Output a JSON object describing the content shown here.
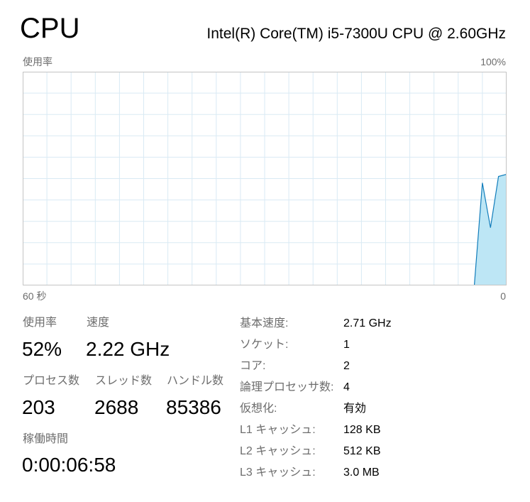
{
  "header": {
    "title": "CPU",
    "model": "Intel(R) Core(TM) i5-7300U CPU @ 2.60GHz"
  },
  "graph": {
    "label_top_left": "使用率",
    "label_top_right": "100%",
    "label_bottom_left": "60 秒",
    "label_bottom_right": "0",
    "line_color": "#117dbb",
    "fill_color": "#bde6f5",
    "grid_color": "#d9eaf4",
    "chart_data": {
      "type": "area",
      "x": [
        60,
        4,
        3,
        2,
        1,
        0
      ],
      "values": [
        0,
        0,
        48,
        27,
        51,
        52
      ],
      "ylim": [
        0,
        100
      ],
      "grid": true
    }
  },
  "stats": {
    "usage": {
      "label": "使用率",
      "value": "52%"
    },
    "speed": {
      "label": "速度",
      "value": "2.22 GHz"
    },
    "processes": {
      "label": "プロセス数",
      "value": "203"
    },
    "threads": {
      "label": "スレッド数",
      "value": "2688"
    },
    "handles": {
      "label": "ハンドル数",
      "value": "85386"
    },
    "uptime": {
      "label": "稼働時間",
      "value": "0:00:06:58"
    }
  },
  "details": [
    {
      "label": "基本速度:",
      "value": "2.71 GHz"
    },
    {
      "label": "ソケット:",
      "value": "1"
    },
    {
      "label": "コア:",
      "value": "2"
    },
    {
      "label": "論理プロセッサ数:",
      "value": "4"
    },
    {
      "label": "仮想化:",
      "value": "有効"
    },
    {
      "label": "L1 キャッシュ:",
      "value": "128 KB"
    },
    {
      "label": "L2 キャッシュ:",
      "value": "512 KB"
    },
    {
      "label": "L3 キャッシュ:",
      "value": "3.0 MB"
    }
  ]
}
